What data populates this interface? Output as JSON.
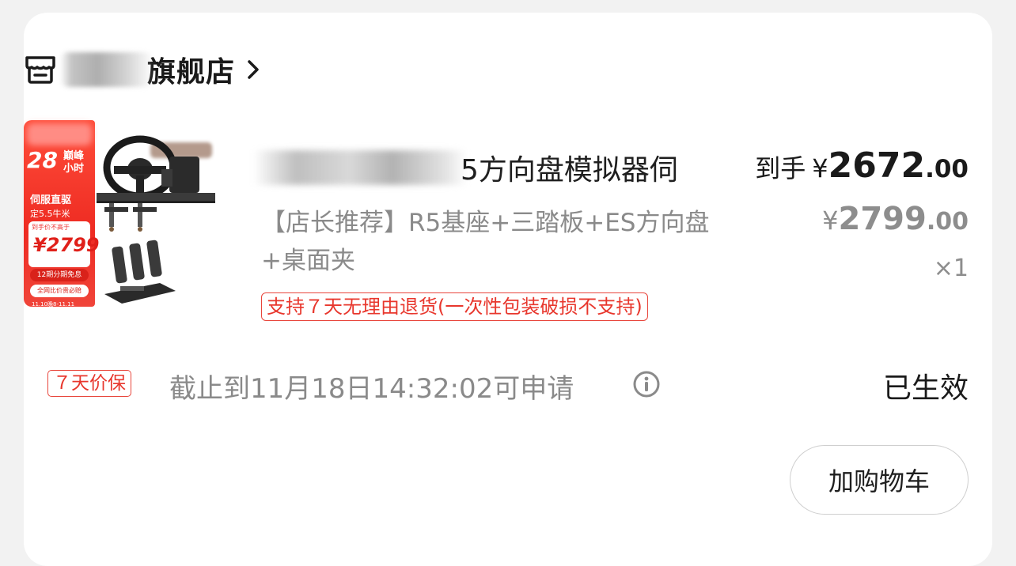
{
  "store": {
    "name_suffix": "旗舰店",
    "icon": "store-icon",
    "chevron": "chevron-right-icon"
  },
  "product": {
    "title_visible": "5方向盘模拟器伺",
    "variant": "【店长推荐】R5基座+三踏板+ES方向盘+桌面夹",
    "return_policy": "支持７天无理由退货(一次性包装破损不支持)",
    "image_promo": {
      "big": "28",
      "side": "巅峰小时",
      "line1": "伺服直驱",
      "line2": "定5.5牛米",
      "tiny": "到手价不高于",
      "price": "¥2799",
      "pill1": "12期分期免息",
      "pill2": "全网比价贵必赔",
      "date": "11.10晚8-11.11"
    }
  },
  "price": {
    "final_label": "到手",
    "final_symbol": "¥",
    "final_int": "2672",
    "final_dec": ".00",
    "orig_symbol": "¥",
    "orig_int": "2799",
    "orig_dec": ".00",
    "quantity": "×1"
  },
  "guarantee": {
    "badge": "７天价保",
    "deadline": "截止到11月18日14:32:02可申请",
    "status": "已生效"
  },
  "actions": {
    "add_to_cart": "加购物车"
  },
  "colors": {
    "accent_red": "#e8372d",
    "gray_text": "#8a8a8a",
    "background": "#f2f2f2"
  }
}
